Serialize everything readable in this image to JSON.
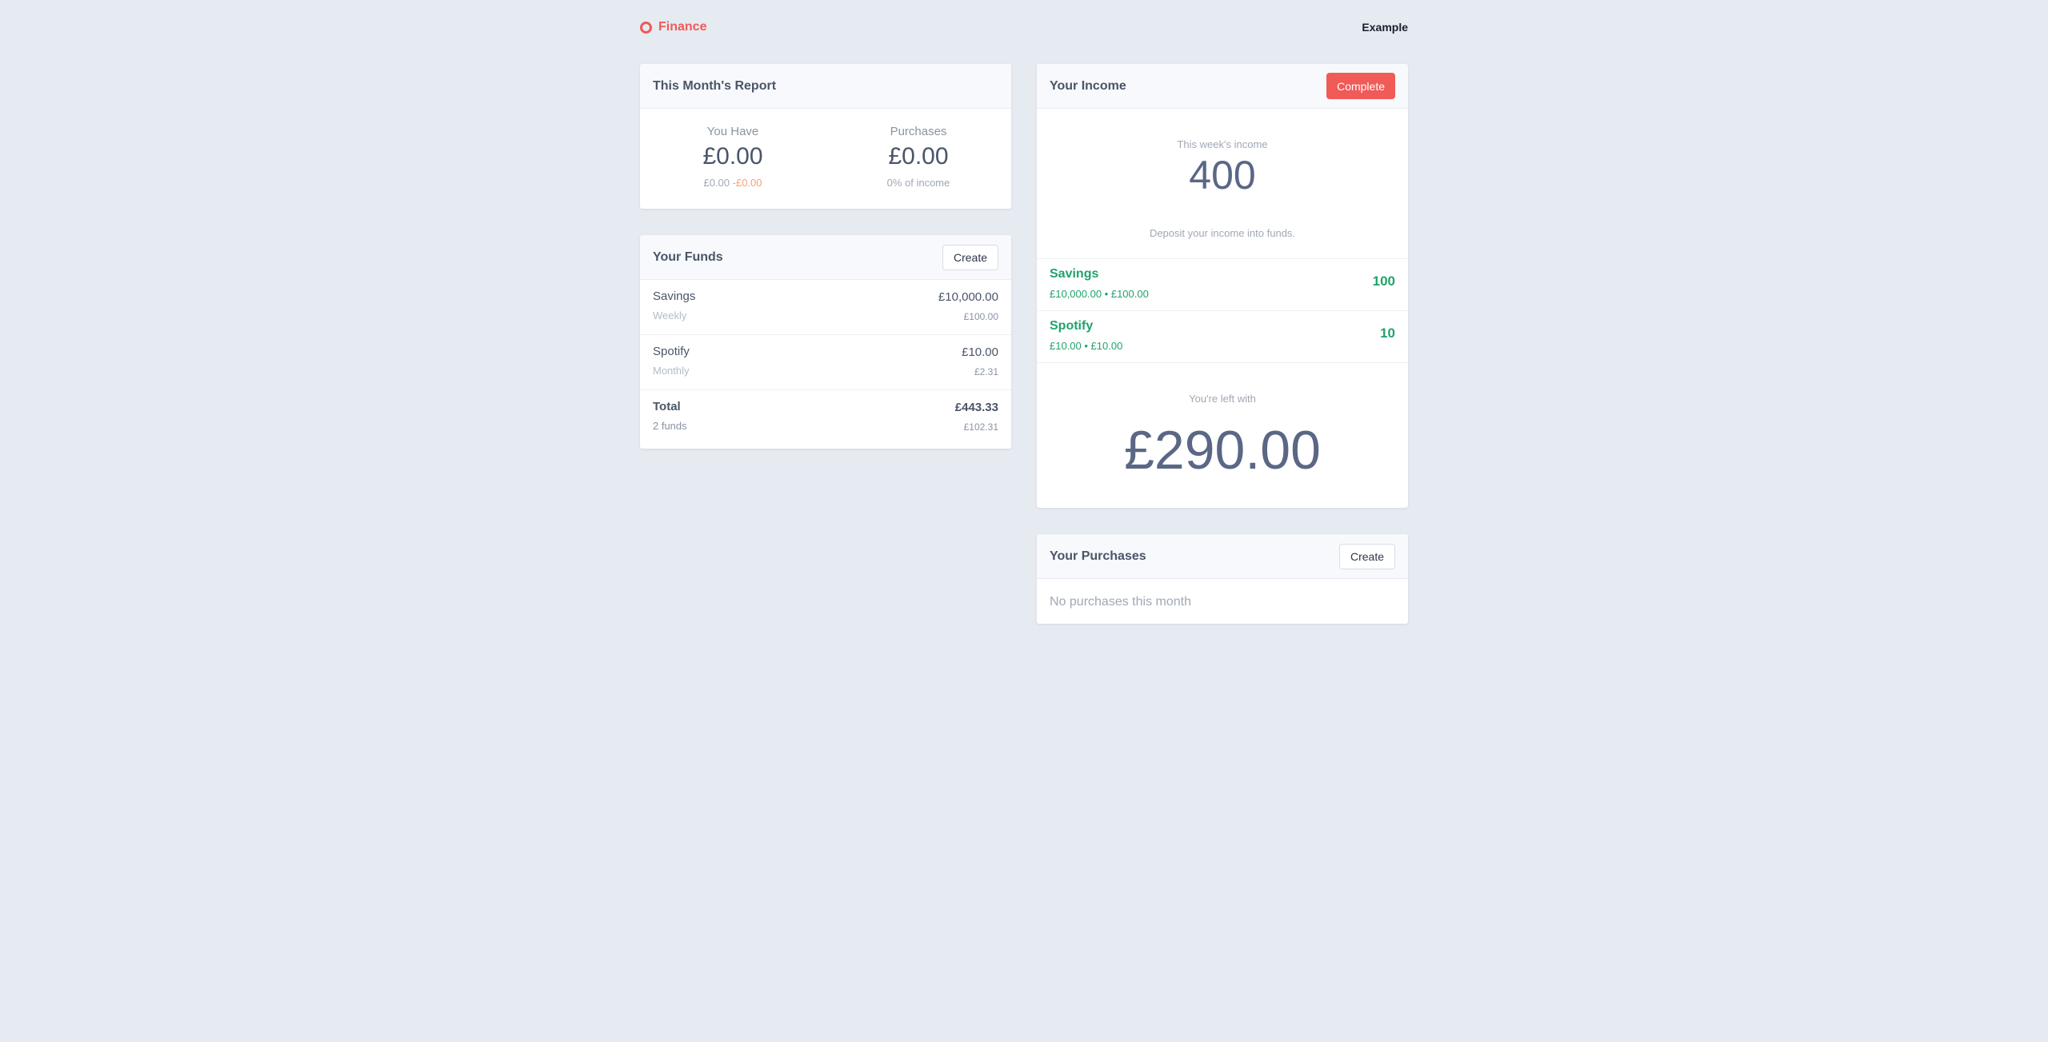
{
  "header": {
    "brand": "Finance",
    "user": "Example"
  },
  "report": {
    "title": "This Month's Report",
    "you_have_label": "You Have",
    "you_have_value": "£0.00",
    "you_have_sub": "£0.00",
    "you_have_sub_neg": "-£0.00",
    "purchases_label": "Purchases",
    "purchases_value": "£0.00",
    "purchases_sub": "0% of income"
  },
  "funds": {
    "title": "Your Funds",
    "create_label": "Create",
    "items": [
      {
        "name": "Savings",
        "frequency": "Weekly",
        "amount": "£10,000.00",
        "rate": "£100.00"
      },
      {
        "name": "Spotify",
        "frequency": "Monthly",
        "amount": "£10.00",
        "rate": "£2.31"
      }
    ],
    "total": {
      "name": "Total",
      "count": "2 funds",
      "amount": "£443.33",
      "rate": "£102.31"
    }
  },
  "income": {
    "title": "Your Income",
    "complete_label": "Complete",
    "week_label": "This week's income",
    "week_value": "400",
    "hint": "Deposit your income into funds.",
    "deposits": [
      {
        "name": "Savings",
        "detail": "£10,000.00 • £100.00",
        "amount": "100"
      },
      {
        "name": "Spotify",
        "detail": "£10.00 • £10.00",
        "amount": "10"
      }
    ],
    "left_label": "You're left with",
    "left_value": "£290.00"
  },
  "purchases": {
    "title": "Your Purchases",
    "create_label": "Create",
    "empty_text": "No purchases this month"
  },
  "colors": {
    "accent": "#f05a57",
    "positive": "#20a36b",
    "background": "#e6eaf1"
  }
}
